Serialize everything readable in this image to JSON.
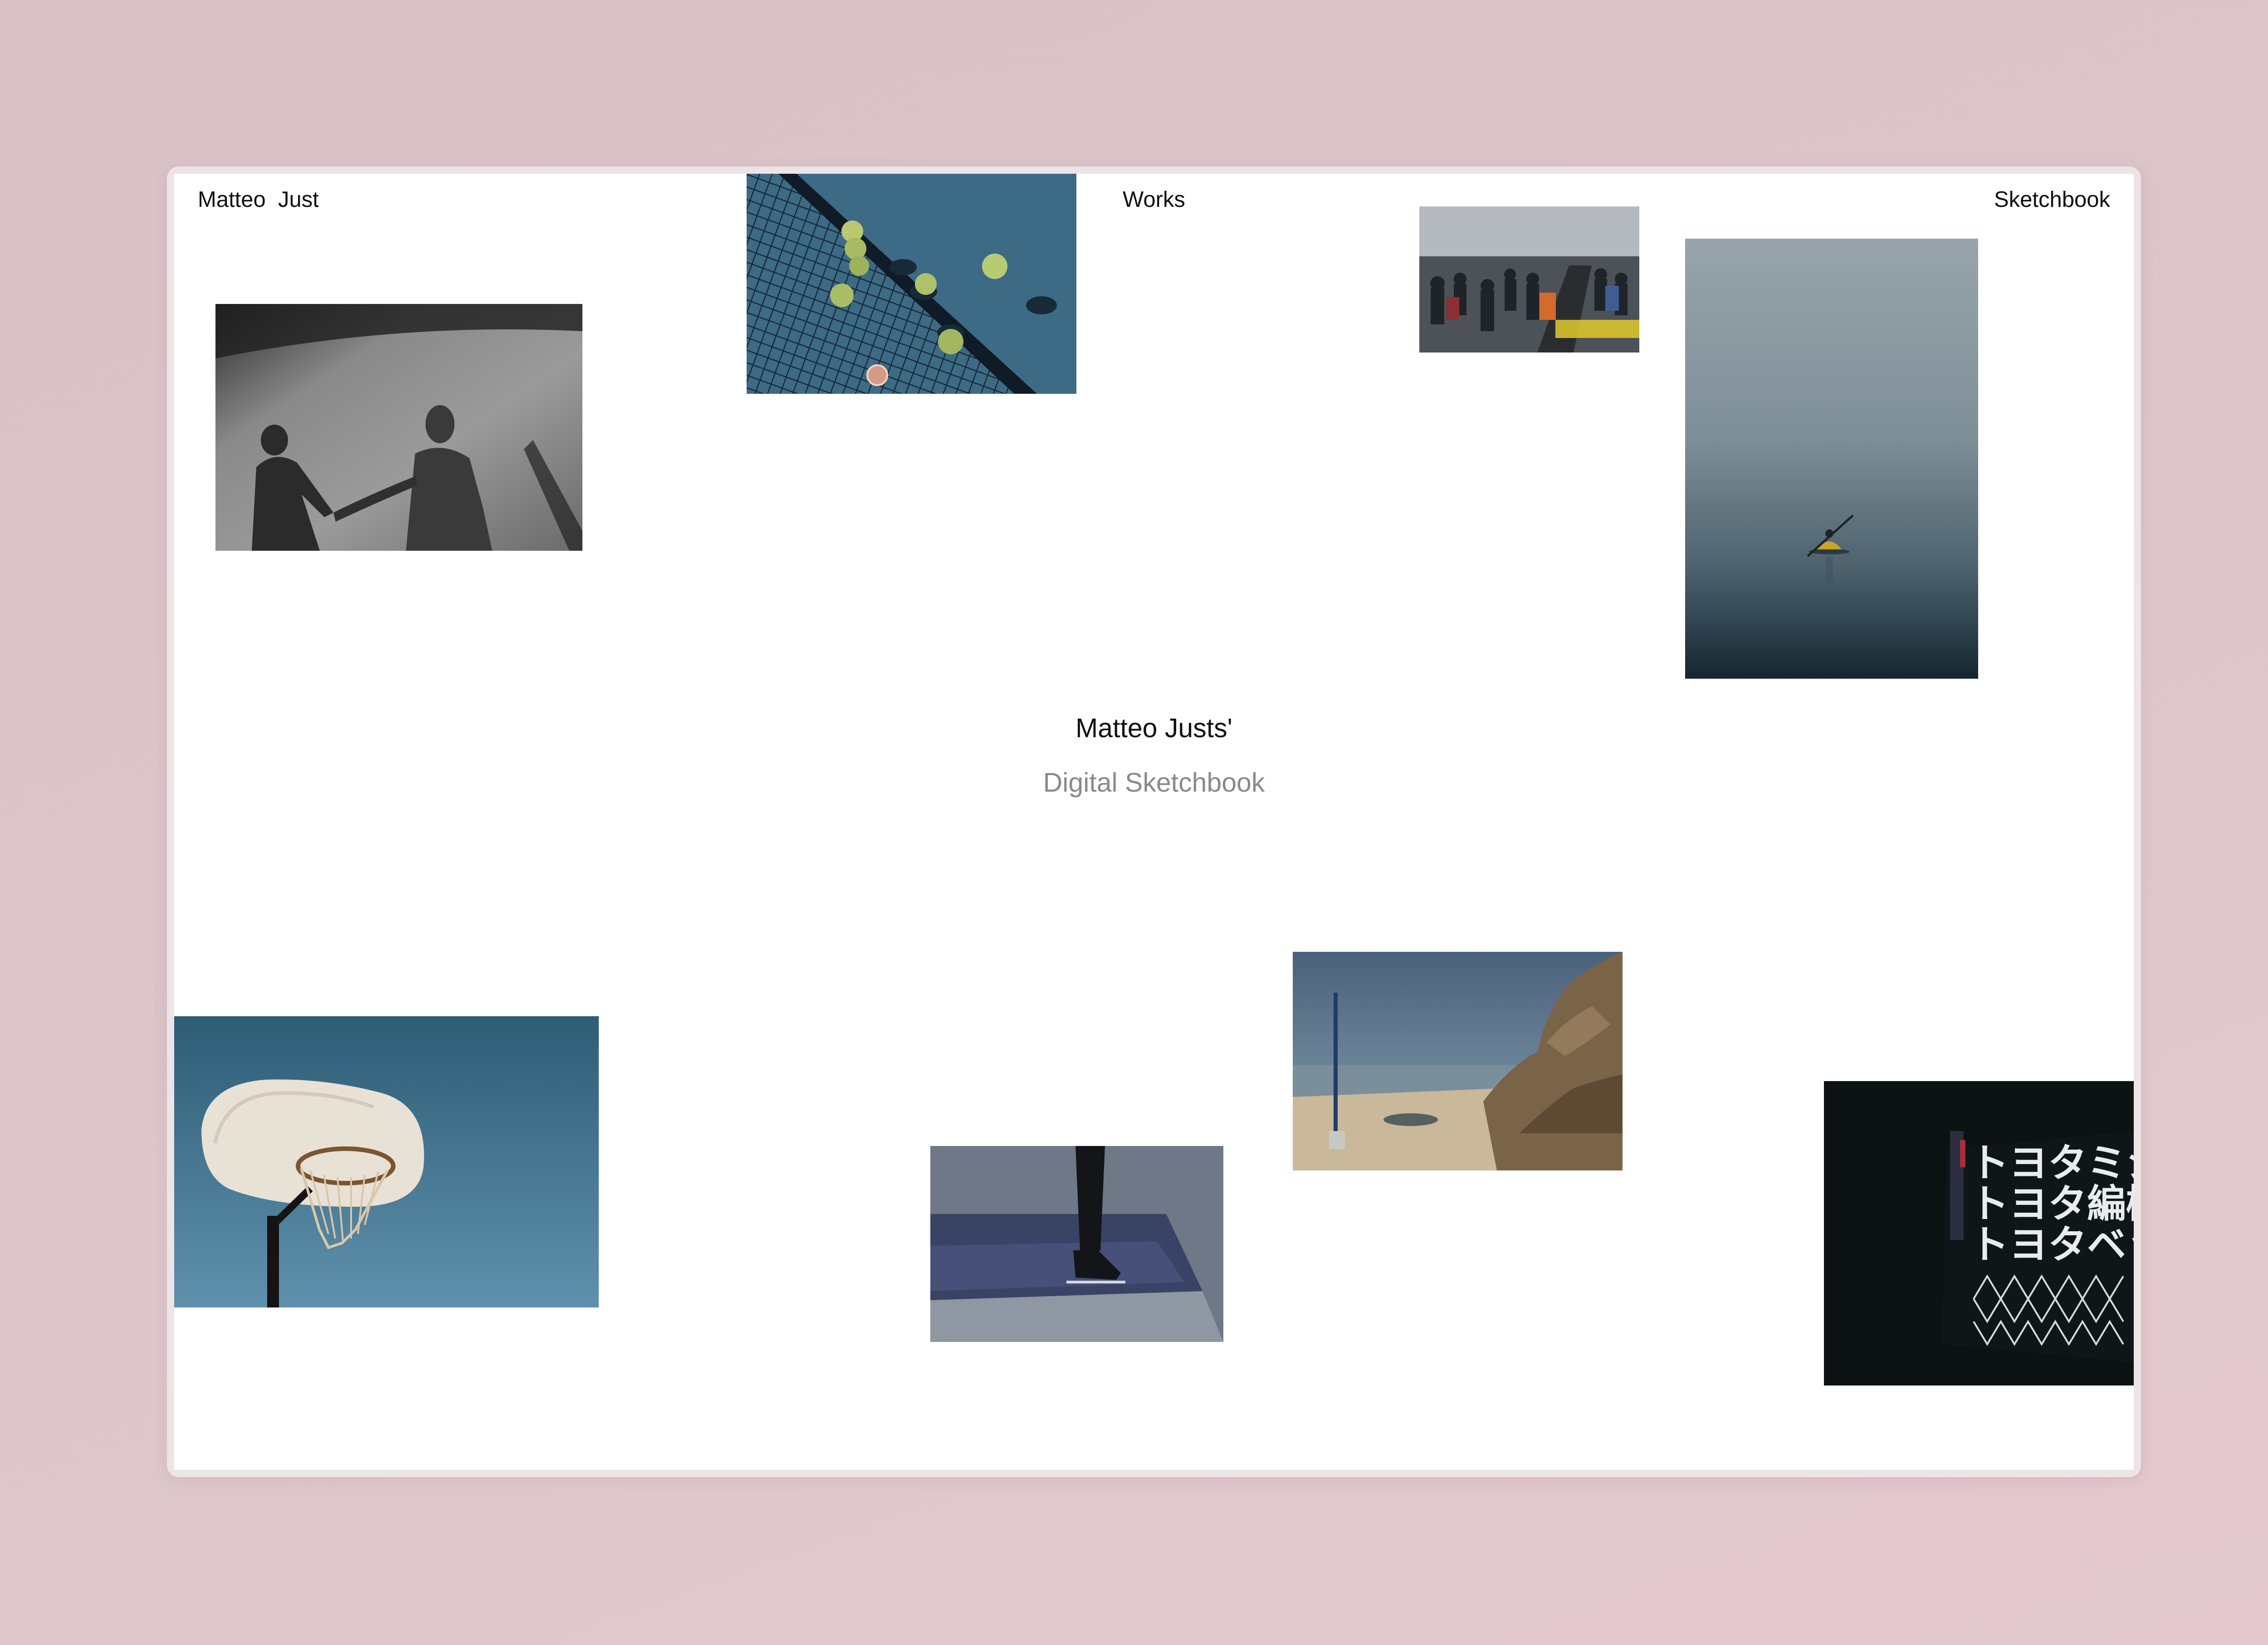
{
  "nav": {
    "home_label": "Matteo  Just",
    "works_label": "Works",
    "sketchbook_label": "Sketchbook"
  },
  "hero": {
    "title": "Matteo Justs'",
    "subtitle": "Digital Sketchbook"
  },
  "signage": {
    "line1": "トヨタミシン",
    "line2": "トヨタ編機",
    "line3": "トヨタベッド"
  },
  "colors": {
    "page_background": "#ffffff",
    "outer_background": "#dcc6ca",
    "title_color": "#111111",
    "subtitle_color": "#8a8a8a"
  }
}
